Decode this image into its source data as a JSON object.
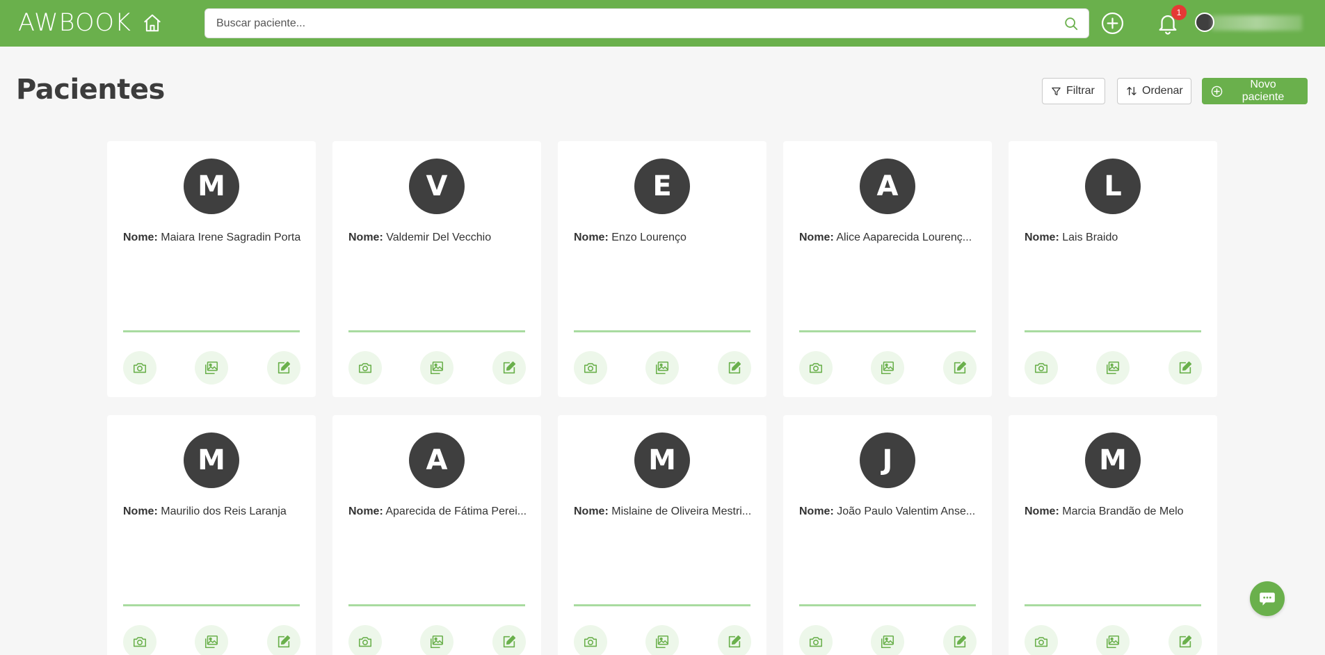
{
  "topbar": {
    "logo": "AWBOOK",
    "search_placeholder": "Buscar paciente...",
    "notification_count": "1"
  },
  "page": {
    "title": "Pacientes",
    "filter_label": "Filtrar",
    "order_label": "Ordenar",
    "new_label": "Novo paciente"
  },
  "name_prefix": "Nome:",
  "patients": [
    {
      "initial": "M",
      "name": "Maiara Irene Sagradin Porta"
    },
    {
      "initial": "V",
      "name": "Valdemir Del Vecchio"
    },
    {
      "initial": "E",
      "name": "Enzo Lourenço"
    },
    {
      "initial": "A",
      "name": "Alice Aaparecida Lourenç..."
    },
    {
      "initial": "L",
      "name": "Lais Braido"
    },
    {
      "initial": "M",
      "name": "Maurilio dos Reis Laranja"
    },
    {
      "initial": "A",
      "name": "Aparecida de Fátima Perei..."
    },
    {
      "initial": "M",
      "name": "Mislaine de Oliveira Mestri..."
    },
    {
      "initial": "J",
      "name": "João Paulo Valentim Anse..."
    },
    {
      "initial": "M",
      "name": "Marcia Brandão de Melo"
    }
  ],
  "colors": {
    "brand": "#6ab04c",
    "avatar": "#3f3f3f",
    "badge": "#e53935"
  }
}
